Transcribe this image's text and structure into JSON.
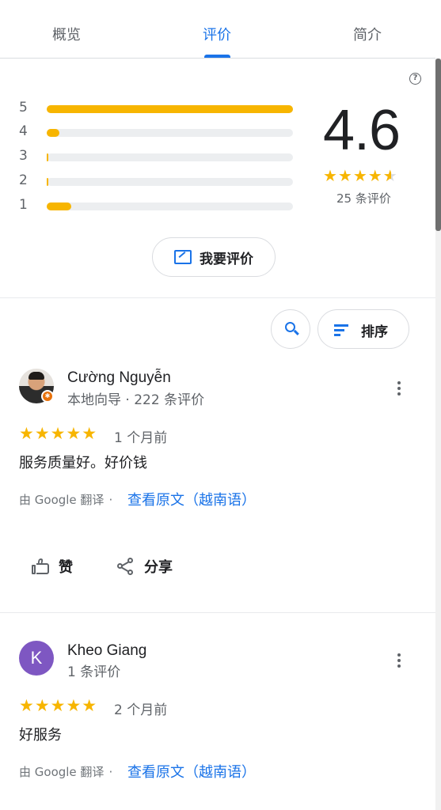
{
  "tabs": [
    {
      "label": "概览"
    },
    {
      "label": "评价"
    },
    {
      "label": "简介"
    }
  ],
  "summary": {
    "help_icon": "question-circle-icon",
    "distribution": [
      {
        "stars": "5",
        "fraction": 1.0
      },
      {
        "stars": "4",
        "fraction": 0.05
      },
      {
        "stars": "3",
        "fraction": 0.005
      },
      {
        "stars": "2",
        "fraction": 0.005
      },
      {
        "stars": "1",
        "fraction": 0.1
      }
    ],
    "rating": "4.6",
    "rating_stars": 4.5,
    "review_count": "25 条评价",
    "write_review_label": "我要评价"
  },
  "controls": {
    "search_icon": "search-icon",
    "sort_label": "排序"
  },
  "reviews": [
    {
      "name": "Cường Nguyễn",
      "meta": "本地向导 · 222 条评价",
      "stars": "★★★★★",
      "time": "1 个月前",
      "text": "服务质量好。好价钱",
      "translated_by": "由 Google 翻译",
      "dot": "·",
      "view_original": "查看原文（越南语）",
      "like_label": "赞",
      "share_label": "分享"
    },
    {
      "name": "Kheo Giang",
      "avatar_letter": "K",
      "meta": "1 条评价",
      "stars": "★★★★★",
      "time": "2 个月前",
      "text": "好服务",
      "translated_by": "由 Google 翻译",
      "dot": "·",
      "view_original": "查看原文（越南语）"
    }
  ],
  "colors": {
    "accent": "#1a73e8",
    "star": "#f7b500",
    "avatar_k": "#7e57c2",
    "guide_badge": "#e8710a"
  }
}
